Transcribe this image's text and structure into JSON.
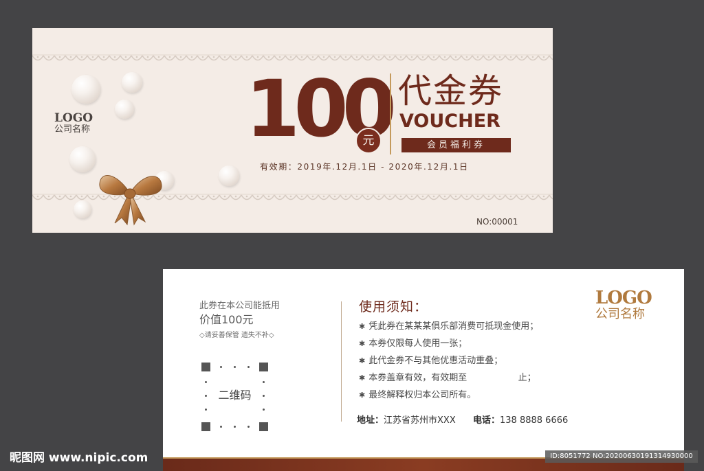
{
  "front": {
    "amount": "100",
    "currency": "元",
    "title_cn": "代金券",
    "title_en": "VOUCHER",
    "member_label": "会员福利券",
    "validity": "有效期：2019年.12月.1日 - 2020年.12月.1日",
    "serial": "NO:00001",
    "logo": "LOGO",
    "company": "公司名称"
  },
  "back": {
    "usage_line1": "此券在本公司能抵用",
    "usage_line2": "价值100元",
    "usage_note": "◇请妥善保管 遗失不补◇",
    "qr_label": "二维码",
    "rules_title": "使用须知：",
    "rules": [
      "凭此券在某某某俱乐部消费可抵现金使用；",
      "本券仅限每人使用一张；",
      "此代金券不与其他优惠活动重叠；",
      "本券盖章有效，有效期至                  止；",
      "最终解释权归本公司所有。"
    ],
    "address_label": "地址：",
    "address": "江苏省苏州市XXX",
    "phone_label": "电话：",
    "phone": "138 8888 6666",
    "logo": "LOGO",
    "company": "公司名称"
  },
  "watermark": {
    "site": "昵图网 www.nipic.com",
    "id": "ID:8051772 NO:20200630191314930000"
  },
  "colors": {
    "brand_brown": "#6e2a1c",
    "gold": "#c49a5c",
    "front_bg": "#f4ece6",
    "page_bg": "#444446"
  },
  "icons": [
    "pearl-icon",
    "bow-icon",
    "qr-code-placeholder"
  ]
}
